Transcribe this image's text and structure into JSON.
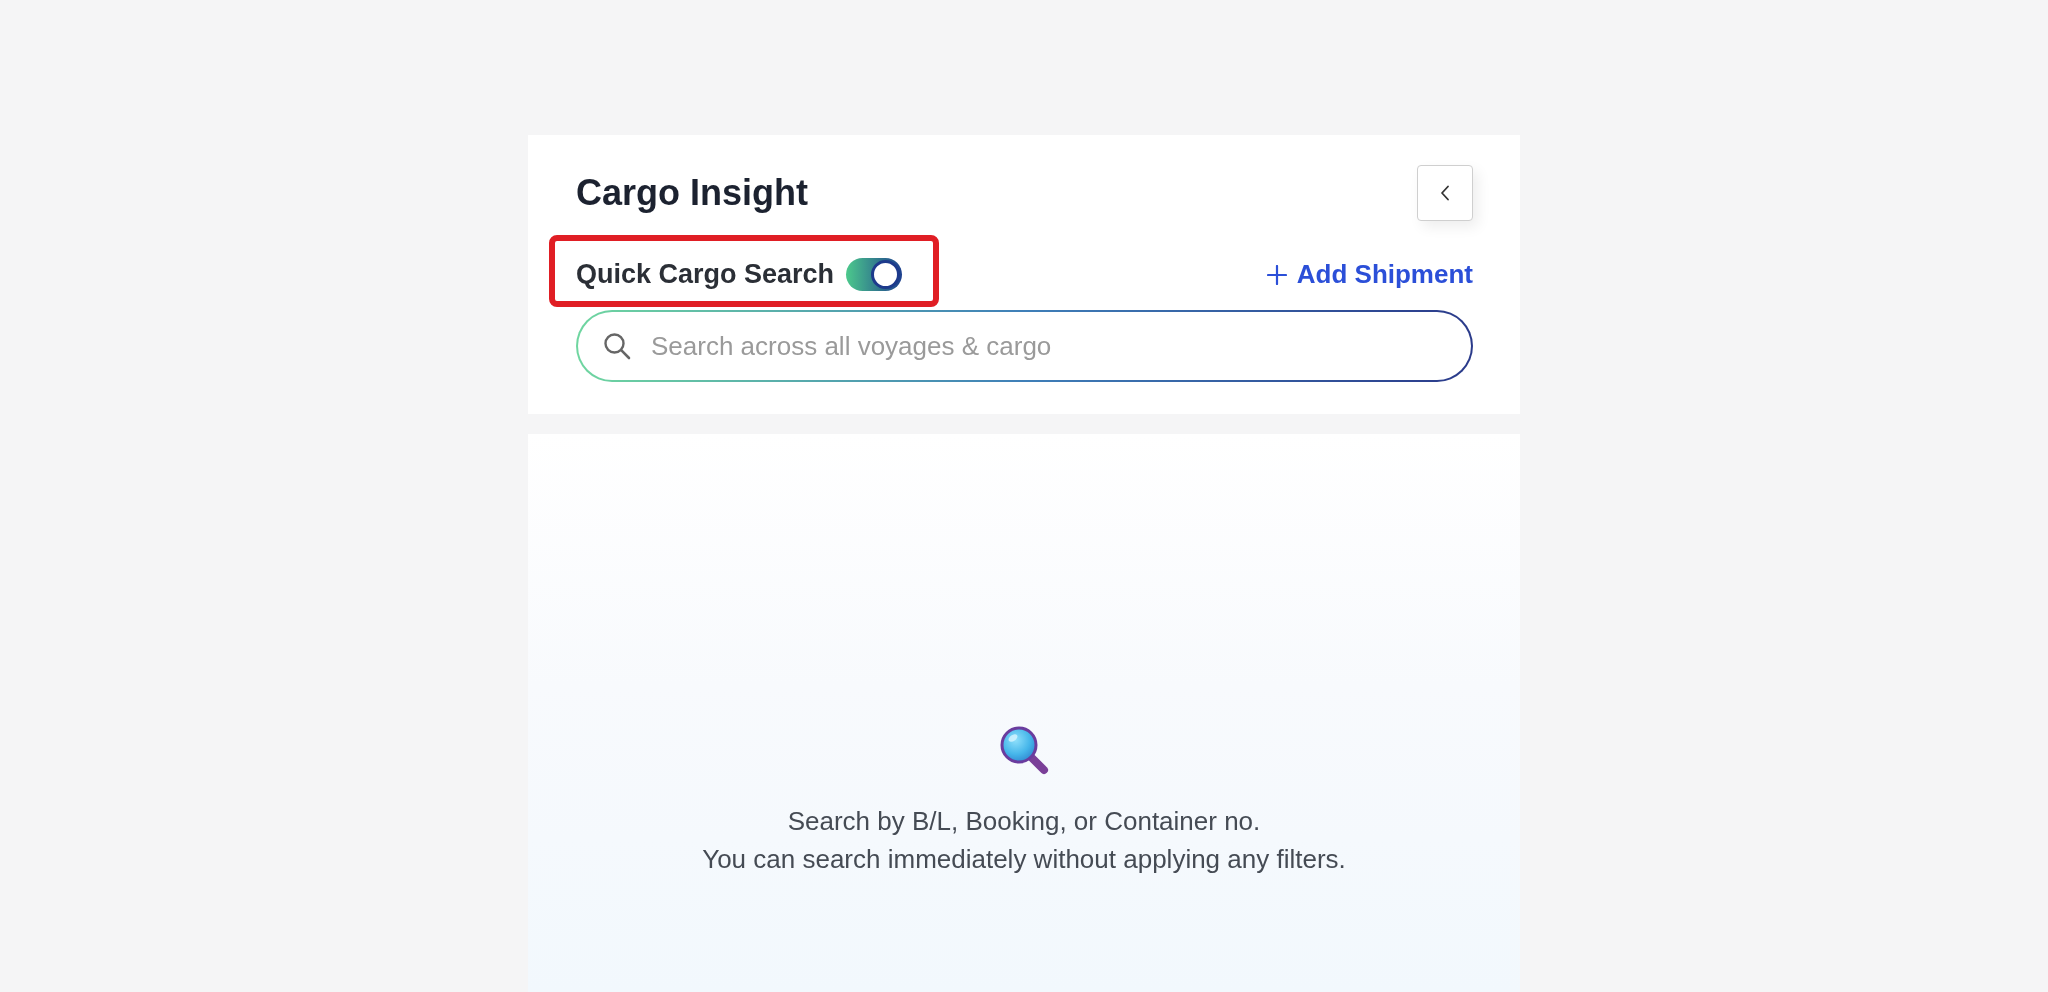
{
  "header": {
    "title": "Cargo Insight"
  },
  "quick_search": {
    "label": "Quick Cargo Search",
    "on": true,
    "highlighted": true
  },
  "add_shipment": {
    "label": "Add Shipment"
  },
  "search": {
    "placeholder": "Search across all voyages & cargo"
  },
  "empty_state": {
    "lines": [
      "Search by B/L, Booking, or Container no.",
      "You can search immediately without applying any filters."
    ]
  }
}
